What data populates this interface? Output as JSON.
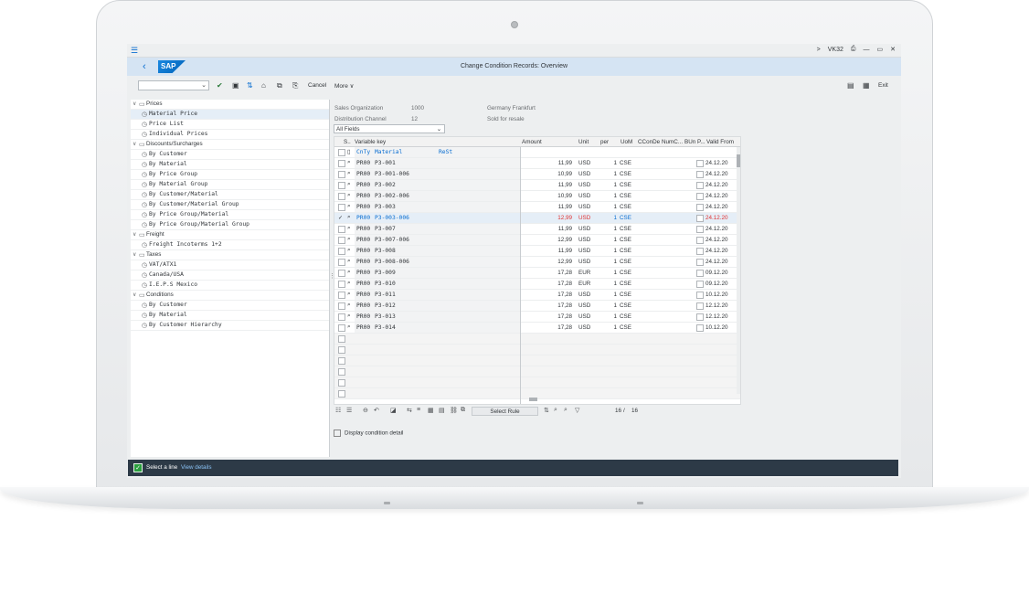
{
  "topbar": {
    "menu_icon": "hamburger-icon",
    "right_items": [
      ">",
      "VK32",
      "⎙",
      "—",
      "▭",
      "✕"
    ]
  },
  "header": {
    "logo": "SAP",
    "title": "Change Condition Records: Overview"
  },
  "toolbar": {
    "cancel": "Cancel",
    "more": "More",
    "more_chevron": "∨",
    "exit": "Exit"
  },
  "tree": [
    {
      "label": "Prices",
      "level": 0
    },
    {
      "label": "Material Price",
      "level": 1,
      "selected": true
    },
    {
      "label": "Price List",
      "level": 1
    },
    {
      "label": "Individual Prices",
      "level": 1
    },
    {
      "label": "Discounts/Surcharges",
      "level": 0
    },
    {
      "label": "By Customer",
      "level": 1
    },
    {
      "label": "By Material",
      "level": 1
    },
    {
      "label": "By Price Group",
      "level": 1
    },
    {
      "label": "By Material Group",
      "level": 1
    },
    {
      "label": "By Customer/Material",
      "level": 1
    },
    {
      "label": "By Customer/Material Group",
      "level": 1
    },
    {
      "label": "By Price Group/Material",
      "level": 1
    },
    {
      "label": "By Price Group/Material Group",
      "level": 1
    },
    {
      "label": "Freight",
      "level": 0
    },
    {
      "label": "Freight Incoterms 1+2",
      "level": 1
    },
    {
      "label": "Taxes",
      "level": 0
    },
    {
      "label": "VAT/ATX1",
      "level": 1
    },
    {
      "label": "Canada/USA",
      "level": 1
    },
    {
      "label": "I.E.P.S Mexico",
      "level": 1
    },
    {
      "label": "Conditions",
      "level": 0
    },
    {
      "label": "By Customer",
      "level": 1
    },
    {
      "label": "By Material",
      "level": 1
    },
    {
      "label": "By Customer Hierarchy",
      "level": 1
    }
  ],
  "info": {
    "sales_org_label": "Sales Organization",
    "sales_org_value": "1000",
    "sales_org_desc": "Germany Frankfurt",
    "dist_channel_label": "Distribution Channel",
    "dist_channel_value": "12",
    "dist_channel_desc": "Sold for resale",
    "fields_select": "All Fields"
  },
  "table": {
    "headers": {
      "s": "S..",
      "key": "Variable key",
      "amount": "Amount",
      "unit": "Unit",
      "per": "per",
      "uom": "UoM",
      "ccond": "CConDe",
      "numc": "NumC...",
      "bun": "BUn P...",
      "valid_from": "Valid From"
    },
    "subheader": {
      "cnty": "CnTy",
      "material": "Material",
      "rest": "ReSt"
    },
    "rows": [
      {
        "ctype": "PR00",
        "material": "P3-001",
        "amount": "11,99",
        "unit": "USD",
        "per": "1",
        "uom": "CSE",
        "valid_from": "24.12.20"
      },
      {
        "ctype": "PR00",
        "material": "P3-001-006",
        "amount": "10,99",
        "unit": "USD",
        "per": "1",
        "uom": "CSE",
        "valid_from": "24.12.20"
      },
      {
        "ctype": "PR00",
        "material": "P3-002",
        "amount": "11,99",
        "unit": "USD",
        "per": "1",
        "uom": "CSE",
        "valid_from": "24.12.20"
      },
      {
        "ctype": "PR00",
        "material": "P3-002-006",
        "amount": "10,99",
        "unit": "USD",
        "per": "1",
        "uom": "CSE",
        "valid_from": "24.12.20"
      },
      {
        "ctype": "PR00",
        "material": "P3-003",
        "amount": "11,99",
        "unit": "USD",
        "per": "1",
        "uom": "CSE",
        "valid_from": "24.12.20"
      },
      {
        "ctype": "PR00",
        "material": "P3-003-006",
        "amount": "12,99",
        "unit": "USD",
        "per": "1",
        "uom": "CSE",
        "valid_from": "24.12.20",
        "selected": true
      },
      {
        "ctype": "PR00",
        "material": "P3-007",
        "amount": "11,99",
        "unit": "USD",
        "per": "1",
        "uom": "CSE",
        "valid_from": "24.12.20"
      },
      {
        "ctype": "PR00",
        "material": "P3-007-006",
        "amount": "12,99",
        "unit": "USD",
        "per": "1",
        "uom": "CSE",
        "valid_from": "24.12.20"
      },
      {
        "ctype": "PR00",
        "material": "P3-008",
        "amount": "11,99",
        "unit": "USD",
        "per": "1",
        "uom": "CSE",
        "valid_from": "24.12.20"
      },
      {
        "ctype": "PR00",
        "material": "P3-008-006",
        "amount": "12,99",
        "unit": "USD",
        "per": "1",
        "uom": "CSE",
        "valid_from": "24.12.20"
      },
      {
        "ctype": "PR00",
        "material": "P3-009",
        "amount": "17,28",
        "unit": "EUR",
        "per": "1",
        "uom": "CSE",
        "valid_from": "09.12.20"
      },
      {
        "ctype": "PR00",
        "material": "P3-010",
        "amount": "17,28",
        "unit": "EUR",
        "per": "1",
        "uom": "CSE",
        "valid_from": "09.12.20"
      },
      {
        "ctype": "PR00",
        "material": "P3-011",
        "amount": "17,28",
        "unit": "USD",
        "per": "1",
        "uom": "CSE",
        "valid_from": "10.12.20"
      },
      {
        "ctype": "PR00",
        "material": "P3-012",
        "amount": "17,28",
        "unit": "USD",
        "per": "1",
        "uom": "CSE",
        "valid_from": "12.12.20"
      },
      {
        "ctype": "PR00",
        "material": "P3-013",
        "amount": "17,28",
        "unit": "USD",
        "per": "1",
        "uom": "CSE",
        "valid_from": "12.12.20"
      },
      {
        "ctype": "PR00",
        "material": "P3-014",
        "amount": "17,28",
        "unit": "USD",
        "per": "1",
        "uom": "CSE",
        "valid_from": "10.12.20"
      }
    ],
    "empty_rows": 6
  },
  "bottom_toolbar": {
    "select_rule": "Select Rule",
    "counter_current": "16",
    "counter_sep": "/",
    "counter_total": "16"
  },
  "detail_link": "Display condition detail",
  "status": {
    "message": "Select a line",
    "link": "View details"
  },
  "colors": {
    "accent": "#0a6ed1",
    "title_bar": "#d5e4f3",
    "status_bar": "#2d3a47",
    "highlight_amount": "#e03232",
    "ok_green": "#2b9e3f"
  }
}
